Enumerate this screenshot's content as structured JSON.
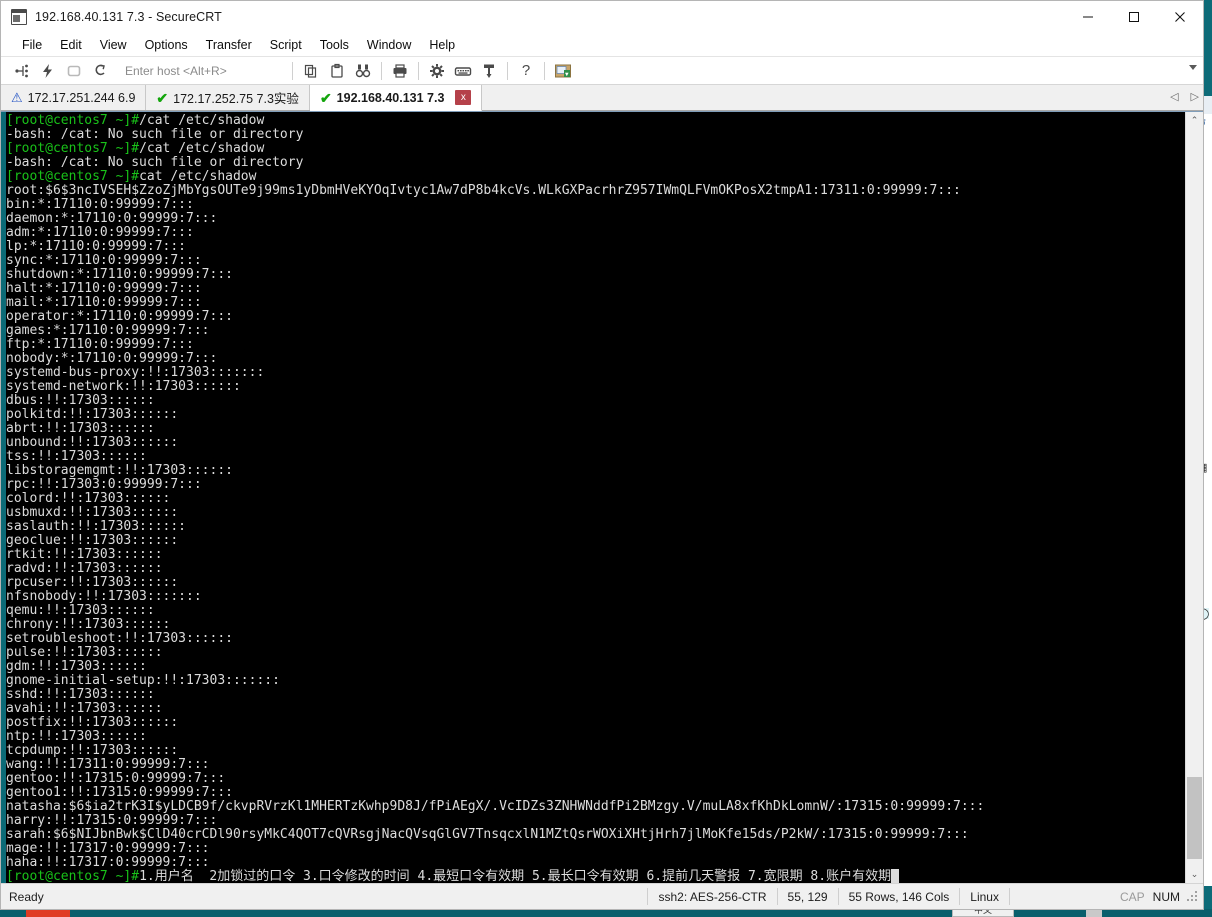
{
  "window": {
    "title": "192.168.40.131 7.3 - SecureCRT",
    "app_icon_name": "securecrt-icon",
    "minimize": "—",
    "maximize": "□",
    "close": "✕"
  },
  "menubar": {
    "items": [
      "File",
      "Edit",
      "View",
      "Options",
      "Transfer",
      "Script",
      "Tools",
      "Window",
      "Help"
    ]
  },
  "toolbar": {
    "host_placeholder": "Enter host <Alt+R>",
    "icons": [
      {
        "name": "connect-icon",
        "glyph": "⸭"
      },
      {
        "name": "quick-connect-icon",
        "glyph": "⚡"
      },
      {
        "name": "connect-in-tab-icon",
        "glyph": "⟳"
      },
      {
        "name": "reconnect-icon",
        "glyph": "⤴"
      },
      {
        "name": "copy-icon",
        "glyph": "⧉"
      },
      {
        "name": "paste-icon",
        "glyph": "Ὄb"
      },
      {
        "name": "find-icon",
        "glyph": "⚖"
      },
      {
        "name": "print-icon",
        "glyph": "⎙"
      },
      {
        "name": "session-options-icon",
        "glyph": "⚙"
      },
      {
        "name": "keyboard-icon",
        "glyph": "⌨"
      },
      {
        "name": "key-icon",
        "glyph": "⚷"
      },
      {
        "name": "help-icon",
        "glyph": "?"
      },
      {
        "name": "file-transfer-icon",
        "glyph": "⎙"
      }
    ],
    "overflow_caret": "▾"
  },
  "tabs": [
    {
      "label": "172.17.251.244 6.9",
      "status": "warning",
      "status_glyph": "⚠",
      "active": false
    },
    {
      "label": "172.17.252.75 7.3实验",
      "status": "ok",
      "status_glyph": "✔",
      "active": false
    },
    {
      "label": "192.168.40.131 7.3",
      "status": "ok",
      "status_glyph": "✔",
      "active": true,
      "close_label": "x"
    }
  ],
  "tab_nav": {
    "prev": "◁",
    "next": "▷"
  },
  "terminal": {
    "lines": [
      [
        {
          "t": "[root@centos7 ~]#",
          "c": "prompt"
        },
        {
          "t": "/cat /etc/shadow",
          "c": "white"
        }
      ],
      [
        {
          "t": "-bash: /cat: No such file or directory",
          "c": "white"
        }
      ],
      [
        {
          "t": "[root@centos7 ~]#",
          "c": "prompt"
        },
        {
          "t": "/cat /etc/shadow",
          "c": "white"
        }
      ],
      [
        {
          "t": "-bash: /cat: No such file or directory",
          "c": "white"
        }
      ],
      [
        {
          "t": "[root@centos7 ~]#",
          "c": "prompt"
        },
        {
          "t": "cat /etc/shadow",
          "c": "white"
        }
      ],
      [
        {
          "t": "root:$6$3ncIVSEH$ZzoZjMbYgsOUTe9j99ms1yDbmHVeKYOqIvtyc1Aw7dP8b4kcVs.WLkGXPacrhrZ957IWmQLFVmOKPosX2tmpA1:17311:0:99999:7:::",
          "c": "white"
        }
      ],
      [
        {
          "t": "bin:*:17110:0:99999:7:::",
          "c": "white"
        }
      ],
      [
        {
          "t": "daemon:*:17110:0:99999:7:::",
          "c": "white"
        }
      ],
      [
        {
          "t": "adm:*:17110:0:99999:7:::",
          "c": "white"
        }
      ],
      [
        {
          "t": "lp:*:17110:0:99999:7:::",
          "c": "white"
        }
      ],
      [
        {
          "t": "sync:*:17110:0:99999:7:::",
          "c": "white"
        }
      ],
      [
        {
          "t": "shutdown:*:17110:0:99999:7:::",
          "c": "white"
        }
      ],
      [
        {
          "t": "halt:*:17110:0:99999:7:::",
          "c": "white"
        }
      ],
      [
        {
          "t": "mail:*:17110:0:99999:7:::",
          "c": "white"
        }
      ],
      [
        {
          "t": "operator:*:17110:0:99999:7:::",
          "c": "white"
        }
      ],
      [
        {
          "t": "games:*:17110:0:99999:7:::",
          "c": "white"
        }
      ],
      [
        {
          "t": "ftp:*:17110:0:99999:7:::",
          "c": "white"
        }
      ],
      [
        {
          "t": "nobody:*:17110:0:99999:7:::",
          "c": "white"
        }
      ],
      [
        {
          "t": "systemd-bus-proxy:!!:17303:::::::",
          "c": "white"
        }
      ],
      [
        {
          "t": "systemd-network:!!:17303::::::",
          "c": "white"
        }
      ],
      [
        {
          "t": "dbus:!!:17303::::::",
          "c": "white"
        }
      ],
      [
        {
          "t": "polkitd:!!:17303::::::",
          "c": "white"
        }
      ],
      [
        {
          "t": "abrt:!!:17303::::::",
          "c": "white"
        }
      ],
      [
        {
          "t": "unbound:!!:17303::::::",
          "c": "white"
        }
      ],
      [
        {
          "t": "tss:!!:17303::::::",
          "c": "white"
        }
      ],
      [
        {
          "t": "libstoragemgmt:!!:17303::::::",
          "c": "white"
        }
      ],
      [
        {
          "t": "rpc:!!:17303:0:99999:7:::",
          "c": "white"
        }
      ],
      [
        {
          "t": "colord:!!:17303::::::",
          "c": "white"
        }
      ],
      [
        {
          "t": "usbmuxd:!!:17303::::::",
          "c": "white"
        }
      ],
      [
        {
          "t": "saslauth:!!:17303::::::",
          "c": "white"
        }
      ],
      [
        {
          "t": "geoclue:!!:17303::::::",
          "c": "white"
        }
      ],
      [
        {
          "t": "rtkit:!!:17303::::::",
          "c": "white"
        }
      ],
      [
        {
          "t": "radvd:!!:17303::::::",
          "c": "white"
        }
      ],
      [
        {
          "t": "rpcuser:!!:17303::::::",
          "c": "white"
        }
      ],
      [
        {
          "t": "nfsnobody:!!:17303:::::::",
          "c": "white"
        }
      ],
      [
        {
          "t": "qemu:!!:17303::::::",
          "c": "white"
        }
      ],
      [
        {
          "t": "chrony:!!:17303::::::",
          "c": "white"
        }
      ],
      [
        {
          "t": "setroubleshoot:!!:17303::::::",
          "c": "white"
        }
      ],
      [
        {
          "t": "pulse:!!:17303::::::",
          "c": "white"
        }
      ],
      [
        {
          "t": "gdm:!!:17303::::::",
          "c": "white"
        }
      ],
      [
        {
          "t": "gnome-initial-setup:!!:17303:::::::",
          "c": "white"
        }
      ],
      [
        {
          "t": "sshd:!!:17303::::::",
          "c": "white"
        }
      ],
      [
        {
          "t": "avahi:!!:17303::::::",
          "c": "white"
        }
      ],
      [
        {
          "t": "postfix:!!:17303::::::",
          "c": "white"
        }
      ],
      [
        {
          "t": "ntp:!!:17303::::::",
          "c": "white"
        }
      ],
      [
        {
          "t": "tcpdump:!!:17303::::::",
          "c": "white"
        }
      ],
      [
        {
          "t": "wang:!!:17311:0:99999:7:::",
          "c": "white"
        }
      ],
      [
        {
          "t": "gentoo:!!:17315:0:99999:7:::",
          "c": "white"
        }
      ],
      [
        {
          "t": "gentoo1:!!:17315:0:99999:7:::",
          "c": "white"
        }
      ],
      [
        {
          "t": "natasha:$6$ia2trK3I$yLDCB9f/ckvpRVrzKl1MHERTzKwhp9D8J/fPiAEgX/.VcIDZs3ZNHWNddfPi2BMzgy.V/muLA8xfKhDkLomnW/:17315:0:99999:7:::",
          "c": "white"
        }
      ],
      [
        {
          "t": "harry:!!:17315:0:99999:7:::",
          "c": "white"
        }
      ],
      [
        {
          "t": "sarah:$6$NIJbnBwk$ClD40crCDl90rsyMkC4QOT7cQVRsgjNacQVsqGlGV7TnsqcxlN1MZtQsrWOXiXHtjHrh7jlMoKfe15ds/P2kW/:17315:0:99999:7:::",
          "c": "white"
        }
      ],
      [
        {
          "t": "mage:!!:17317:0:99999:7:::",
          "c": "white"
        }
      ],
      [
        {
          "t": "haha:!!:17317:0:99999:7:::",
          "c": "white"
        }
      ],
      [
        {
          "t": "[root@centos7 ~]#",
          "c": "prompt"
        },
        {
          "t": "1.用户名  2加锁过的口令 3.口令修改的时间 4.最短口令有效期 5.最长口令有效期 6.提前几天警报 7.宽限期 8.账户有效期",
          "c": "white"
        }
      ]
    ],
    "scroll_up": "⌃",
    "scroll_down": "⌄"
  },
  "statusbar": {
    "ready": "Ready",
    "encryption": "ssh2: AES-256-CTR",
    "cursor": "55, 129",
    "dimensions": "55 Rows, 146 Cols",
    "emulation": "Linux",
    "caps": "CAP",
    "num": "NUM"
  },
  "background": {
    "ime_label": "中文"
  }
}
